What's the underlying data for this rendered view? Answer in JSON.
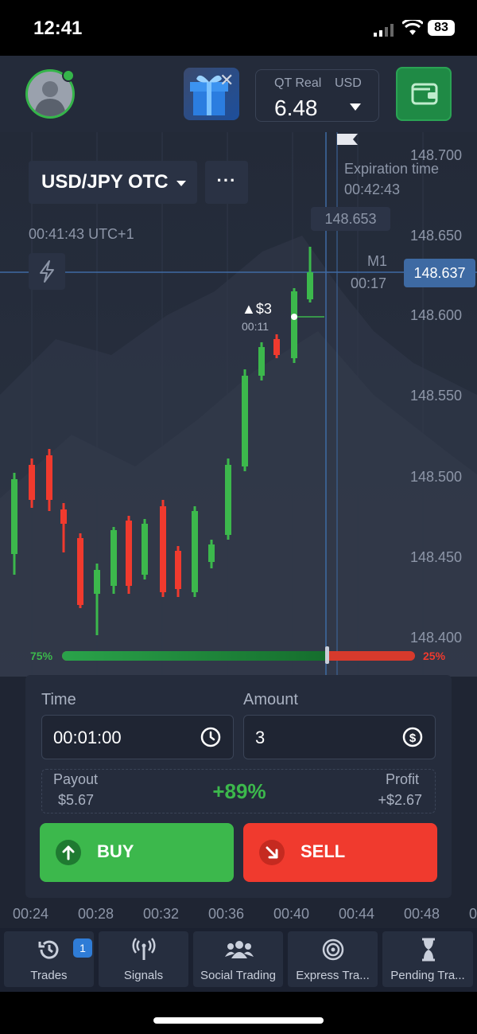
{
  "status_bar": {
    "time": "12:41",
    "battery": "83"
  },
  "header": {
    "account_type": "QT Real",
    "currency": "USD",
    "balance": "6.48"
  },
  "chart": {
    "pair": "USD/JPY OTC",
    "more": "···",
    "server_time": "00:41:43 UTC+1",
    "expiration_label": "Expiration time",
    "expiration_time": "00:42:43",
    "hover_price": "148.653",
    "timeframe": "M1",
    "candle_timer": "00:17",
    "current_price": "148.637",
    "trade_marker": "▲$3",
    "trade_marker_time": "00:11",
    "y_labels": [
      "148.700",
      "148.650",
      "148.600",
      "148.550",
      "148.500",
      "148.450",
      "148.400"
    ],
    "x_labels": [
      "00:24",
      "00:28",
      "00:32",
      "00:36",
      "00:40",
      "00:44",
      "00:48",
      "0"
    ]
  },
  "sentiment": {
    "buy_pct": "75%",
    "sell_pct": "25%",
    "buy_fraction": 0.75
  },
  "trade_panel": {
    "time_label": "Time",
    "time_value": "00:01:00",
    "amount_label": "Amount",
    "amount_value": "3",
    "payout_label": "Payout",
    "payout_value": "$5.67",
    "payout_pct": "+89%",
    "profit_label": "Profit",
    "profit_value": "+$2.67",
    "buy_label": "BUY",
    "sell_label": "SELL"
  },
  "nav": {
    "items": [
      {
        "label": "Trades",
        "icon": "history-icon",
        "badge": "1"
      },
      {
        "label": "Signals",
        "icon": "signal-icon"
      },
      {
        "label": "Social Trading",
        "icon": "users-icon"
      },
      {
        "label": "Express Tra...",
        "icon": "target-icon"
      },
      {
        "label": "Pending Tra...",
        "icon": "hourglass-icon"
      }
    ]
  },
  "colors": {
    "up": "#3cb84c",
    "down": "#f03a2e",
    "accent": "#3e6aa3"
  }
}
